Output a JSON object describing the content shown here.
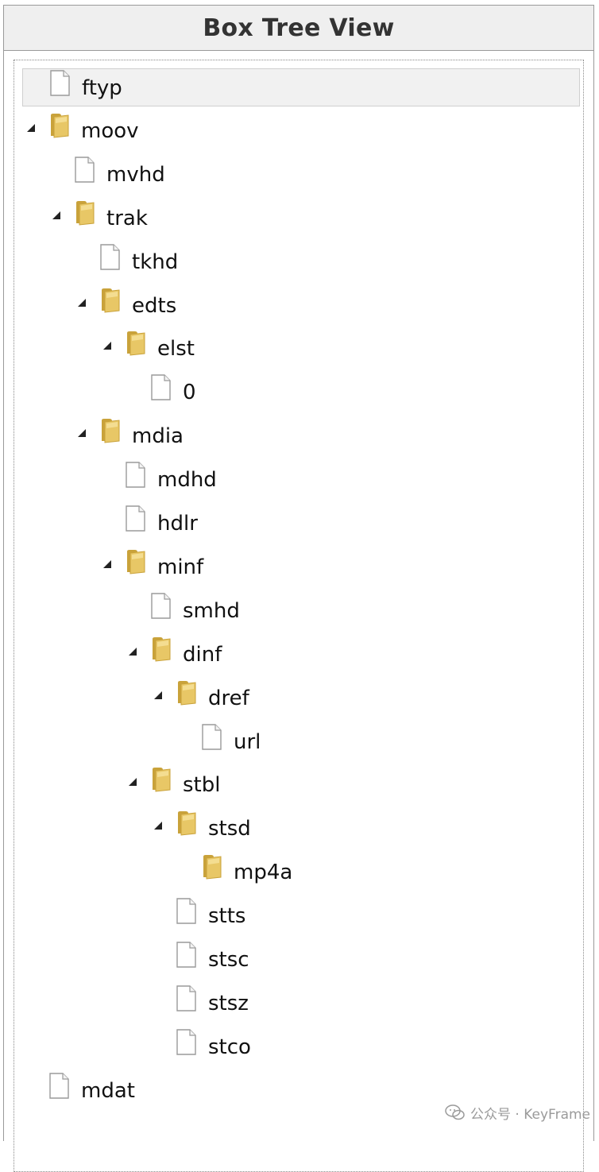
{
  "panel": {
    "title": "Box Tree View"
  },
  "tree": [
    {
      "label": "ftyp",
      "type": "file",
      "depth": 0,
      "expanded": false,
      "selected": true
    },
    {
      "label": "moov",
      "type": "folder",
      "depth": 0,
      "expanded": true
    },
    {
      "label": "mvhd",
      "type": "file",
      "depth": 1
    },
    {
      "label": "trak",
      "type": "folder",
      "depth": 1,
      "expanded": true
    },
    {
      "label": "tkhd",
      "type": "file",
      "depth": 2
    },
    {
      "label": "edts",
      "type": "folder",
      "depth": 2,
      "expanded": true
    },
    {
      "label": "elst",
      "type": "folder",
      "depth": 3,
      "expanded": true
    },
    {
      "label": "0",
      "type": "file",
      "depth": 4
    },
    {
      "label": "mdia",
      "type": "folder",
      "depth": 2,
      "expanded": true
    },
    {
      "label": "mdhd",
      "type": "file",
      "depth": 3
    },
    {
      "label": "hdlr",
      "type": "file",
      "depth": 3
    },
    {
      "label": "minf",
      "type": "folder",
      "depth": 3,
      "expanded": true
    },
    {
      "label": "smhd",
      "type": "file",
      "depth": 4
    },
    {
      "label": "dinf",
      "type": "folder",
      "depth": 4,
      "expanded": true
    },
    {
      "label": "dref",
      "type": "folder",
      "depth": 5,
      "expanded": true
    },
    {
      "label": "url",
      "type": "file",
      "depth": 6
    },
    {
      "label": "stbl",
      "type": "folder",
      "depth": 4,
      "expanded": true
    },
    {
      "label": "stsd",
      "type": "folder",
      "depth": 5,
      "expanded": true
    },
    {
      "label": "mp4a",
      "type": "folder",
      "depth": 6,
      "expanded": false,
      "leaf": true
    },
    {
      "label": "stts",
      "type": "file",
      "depth": 5
    },
    {
      "label": "stsc",
      "type": "file",
      "depth": 5
    },
    {
      "label": "stsz",
      "type": "file",
      "depth": 5
    },
    {
      "label": "stco",
      "type": "file",
      "depth": 5
    },
    {
      "label": "mdat",
      "type": "file",
      "depth": 0
    }
  ],
  "watermark": {
    "text": "公众号 · KeyFrame",
    "icon": "wechat-icon"
  },
  "colors": {
    "folder": "#e8c766",
    "folder_dark": "#c9a23a",
    "file": "#ffffff",
    "file_border": "#9a9a9a",
    "toggle": "#222222"
  }
}
